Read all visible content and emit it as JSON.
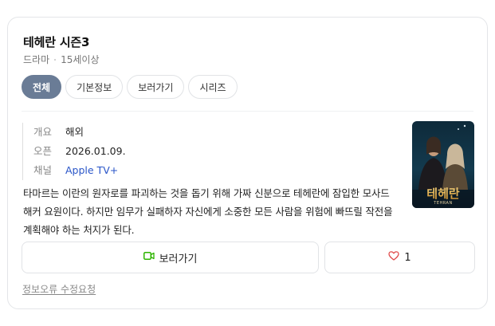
{
  "title": "테헤란 시즌3",
  "meta": {
    "genre": "드라마",
    "rating": "15세이상"
  },
  "tabs": [
    {
      "label": "전체",
      "active": true
    },
    {
      "label": "기본정보",
      "active": false
    },
    {
      "label": "보러가기",
      "active": false
    },
    {
      "label": "시리즈",
      "active": false
    }
  ],
  "info": {
    "overview_key": "개요",
    "overview_value": "해외",
    "open_key": "오픈",
    "open_value": "2026.01.09.",
    "channel_key": "채널",
    "channel_value": "Apple TV+"
  },
  "poster": {
    "title": "테헤란",
    "subtitle": "TEHRAN"
  },
  "description": "타마르는 이란의 원자로를 파괴하는 것을 돕기 위해 가짜 신분으로 테헤란에 잠입한 모사드 해커 요원이다. 하지만 임무가 실패하자 자신에게 소중한 모든 사람을 위험에 빠뜨릴 작전을 계획해야 하는 처지가 된다.",
  "buttons": {
    "watch_label": "보러가기",
    "like_count": "1"
  },
  "report_link": "정보오류 수정요청",
  "colors": {
    "active_tab": "#6a7c96",
    "link": "#2955c8",
    "play_icon": "#2db400",
    "heart_icon": "#e04b4b"
  }
}
